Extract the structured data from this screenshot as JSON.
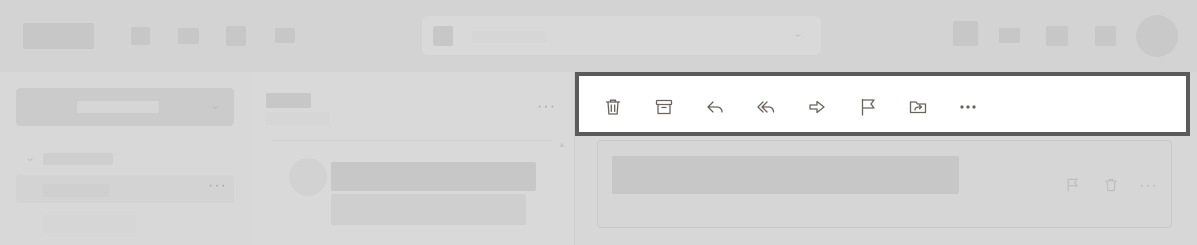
{
  "toolbar": {
    "buttons": [
      {
        "name": "delete",
        "icon": "trash-icon"
      },
      {
        "name": "archive",
        "icon": "archive-icon"
      },
      {
        "name": "reply",
        "icon": "reply-icon"
      },
      {
        "name": "reply-all",
        "icon": "reply-all-icon"
      },
      {
        "name": "forward",
        "icon": "forward-icon"
      },
      {
        "name": "flag",
        "icon": "flag-icon"
      },
      {
        "name": "move",
        "icon": "move-to-folder-icon"
      },
      {
        "name": "more",
        "icon": "more-icon"
      }
    ]
  },
  "colors": {
    "toolbar_background": "#ffffff",
    "toolbar_border": "#5b5b5b",
    "icon_color": "#6b635b",
    "dimmed_background": "#dcdcdc"
  }
}
